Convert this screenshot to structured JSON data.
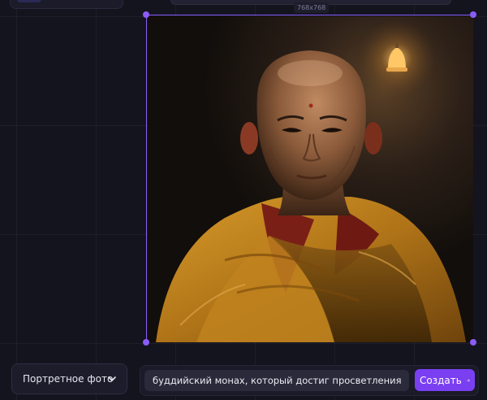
{
  "canvas": {
    "image_size_label": "768x768"
  },
  "toolbar": {
    "style_select_value": "Портретное фото",
    "prompt_value": "буддийский монах, который достиг просветления",
    "create_label": "Создать"
  },
  "colors": {
    "accent": "#7b3ff2",
    "selection": "#8a5cf6",
    "background": "#14141f"
  }
}
